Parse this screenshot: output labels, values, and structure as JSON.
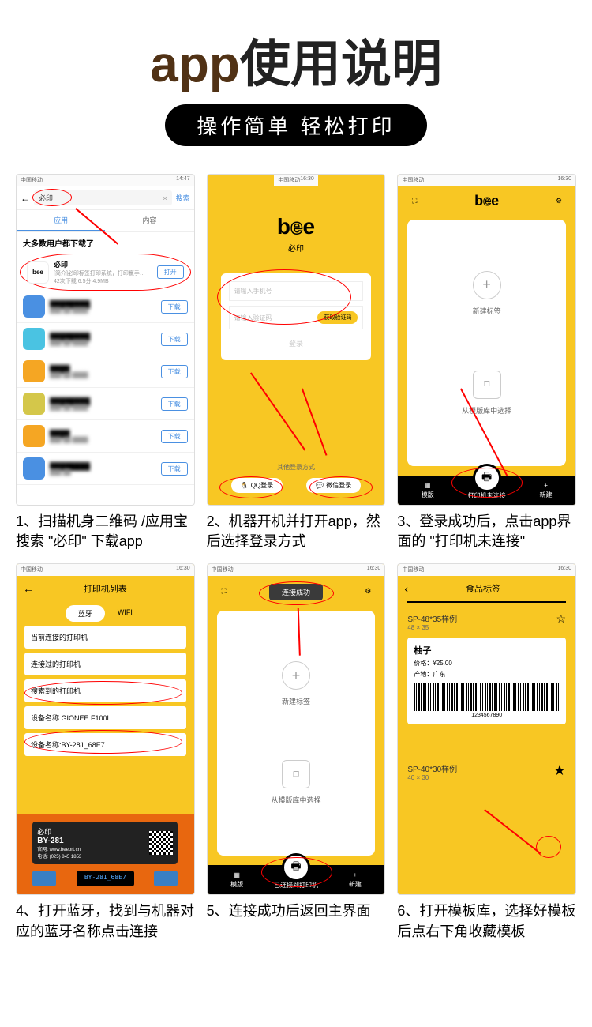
{
  "header": {
    "title_part1": "app",
    "title_part2": "使用说明",
    "subtitle": "操作简单 轻松打印"
  },
  "screens": {
    "s1": {
      "search_text": "必印",
      "search_btn": "搜索",
      "tab1": "应用",
      "tab2": "内容",
      "hint": "大多数用户都下载了",
      "app1_name": "必印",
      "app1_desc": "[简介]必印标签打印系统，打印赢手…",
      "app1_meta": "42次下载 6.5分 4.9MB",
      "open_btn": "打开",
      "dl_btn": "下载"
    },
    "s2": {
      "logo": "bee",
      "app_name": "必印",
      "phone_ph": "请输入手机号",
      "code_ph": "请输入验证码",
      "code_btn": "获取验证码",
      "login_btn": "登录",
      "other_txt": "其他登录方式",
      "qq": "QQ登录",
      "wechat": "微信登录"
    },
    "s3": {
      "new_label": "新建标签",
      "from_template": "从模版库中选择",
      "nav_template": "模版",
      "nav_printer": "打印机未连接",
      "nav_new": "新建"
    },
    "s4": {
      "title": "打印机列表",
      "bt": "蓝牙",
      "wifi": "WIFI",
      "item1": "当前连接的打印机",
      "item2": "连接过的打印机",
      "item3": "搜索到的打印机",
      "item4": "设备名称:GIONEE F100L",
      "item5": "设备名称:BY-281_68E7",
      "dev_brand": "必印",
      "dev_model": "BY-281",
      "dev_site": "官网: www.beeprt.cn",
      "dev_tel": "电话: (025) 845 1853",
      "display": "BY-281_68E7"
    },
    "s5": {
      "toast": "连接成功",
      "nav_printer": "已连接到打印机"
    },
    "s6": {
      "title": "食品标签",
      "t1_name": "SP-48*35样例",
      "t1_size": "48 × 35",
      "label_name": "柚子",
      "label_price": "价格：¥25.00",
      "label_origin": "产地：广东",
      "barcode_num": "1234567890",
      "t2_name": "SP-40*30样例",
      "t2_size": "40 × 30"
    }
  },
  "captions": {
    "c1": "1、扫描机身二维码 /应用宝搜索 \"必印\" 下载app",
    "c2": "2、机器开机并打开app，然后选择登录方式",
    "c3": "3、登录成功后，点击app界面的 \"打印机未连接\"",
    "c4": "4、打开蓝牙，找到与机器对应的蓝牙名称点击连接",
    "c5": "5、连接成功后返回主界面",
    "c6": "6、打开模板库，选择好模板后点右下角收藏模板"
  }
}
